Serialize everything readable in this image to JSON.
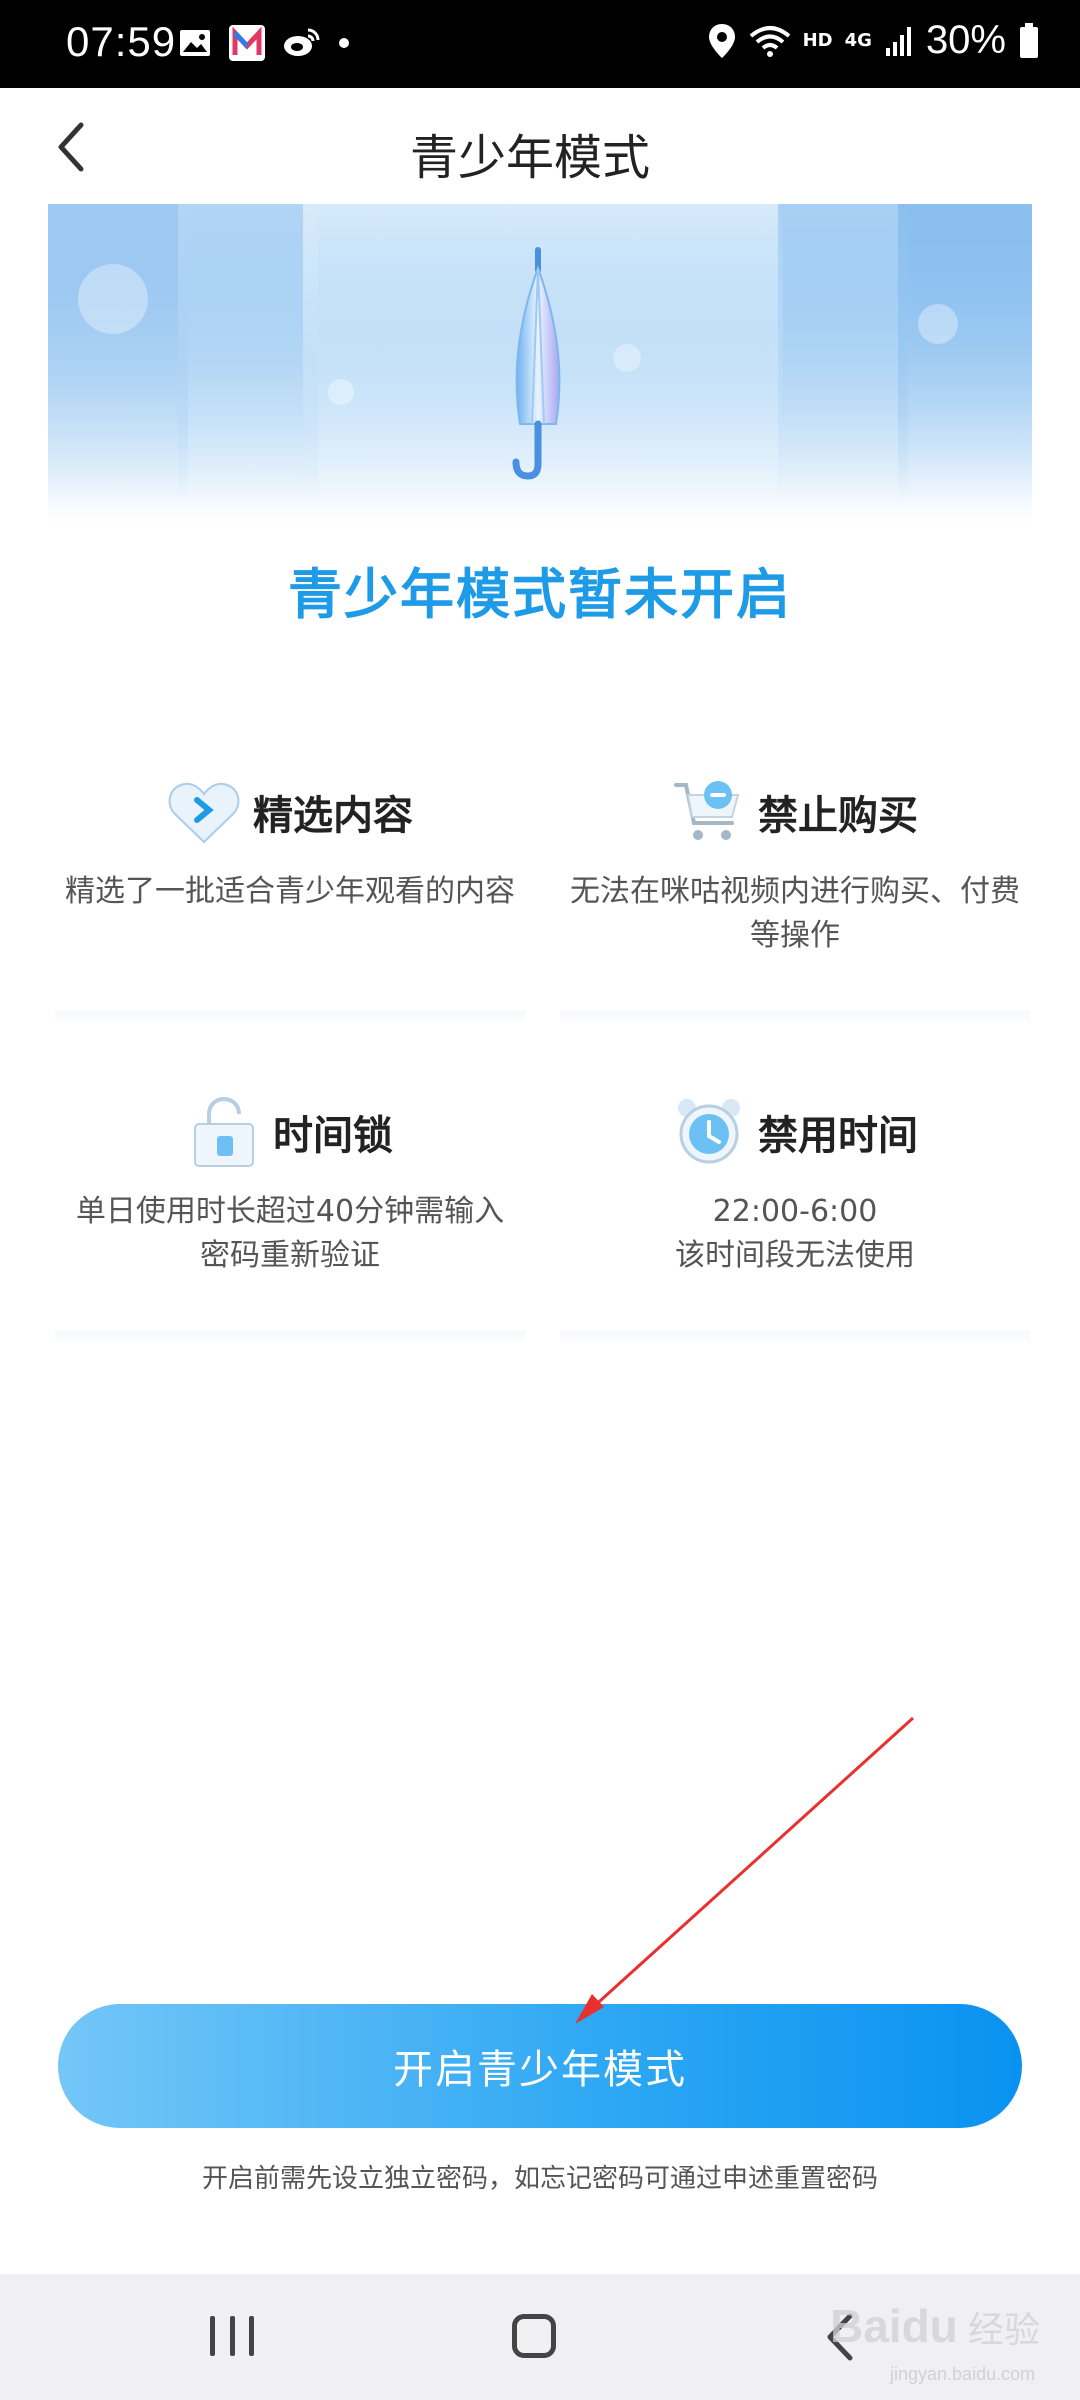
{
  "status_bar": {
    "time": "07:59",
    "network": "HD",
    "network_gen": "4G",
    "battery": "30%"
  },
  "header": {
    "title": "青少年模式"
  },
  "main": {
    "status_heading": "青少年模式暂未开启",
    "features": [
      {
        "title": "精选内容",
        "desc": "精选了一批适合青少年观看的内容",
        "icon": "heart-chevron-icon"
      },
      {
        "title": "禁止购买",
        "desc": "无法在咪咕视频内进行购买、付费等操作",
        "icon": "shopping-cart-icon"
      },
      {
        "title": "时间锁",
        "desc": "单日使用时长超过40分钟需输入密码重新验证",
        "icon": "lock-icon"
      },
      {
        "title": "禁用时间",
        "desc_line1": "22:00-6:00",
        "desc_line2": "该时间段无法使用",
        "icon": "alarm-clock-icon"
      }
    ],
    "enable_button": "开启青少年模式",
    "hint": "开启前需先设立独立密码，如忘记密码可通过申述重置密码"
  },
  "watermark": {
    "brand": "Baidu",
    "brand_cn": "经验",
    "url": "jingyan.baidu.com"
  },
  "colors": {
    "accent": "#1e9be6",
    "button_start": "#74c6f7",
    "button_end": "#0a92f1",
    "annotation_arrow": "#e8312f"
  }
}
